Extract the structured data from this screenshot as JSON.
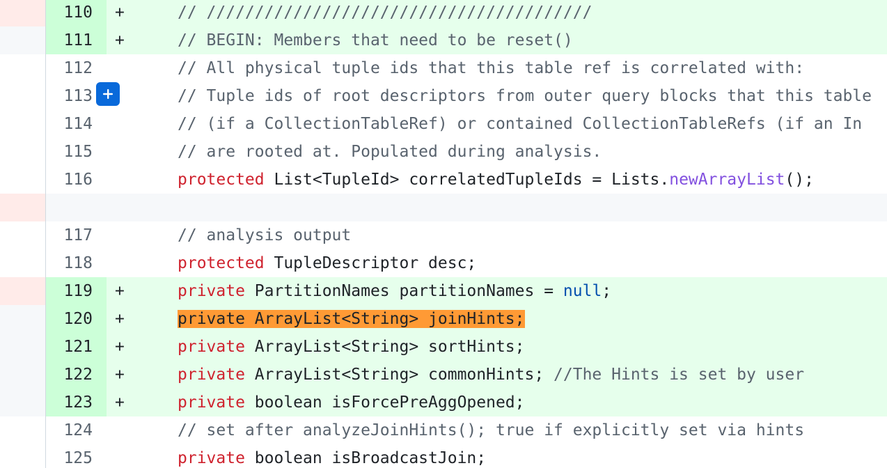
{
  "lines": [
    {
      "num": "110",
      "marker": "+",
      "code": "// ////////////////////////////////////////"
    },
    {
      "num": "111",
      "marker": "+",
      "code": "// BEGIN: Members that need to be reset()"
    },
    {
      "num": "112",
      "marker": "",
      "code": "// All physical tuple ids that this table ref is correlated with:"
    },
    {
      "num": "113",
      "marker": "",
      "code": "// Tuple ids of root descriptors from outer query blocks that this table"
    },
    {
      "num": "114",
      "marker": "",
      "code": "// (if a CollectionTableRef) or contained CollectionTableRefs (if an In"
    },
    {
      "num": "115",
      "marker": "",
      "code": "// are rooted at. Populated during analysis."
    },
    {
      "num": "116",
      "marker": "",
      "kw": "protected",
      "rest1": " List<TupleId> correlatedTupleIds = Lists.",
      "fn": "newArrayList",
      "rest2": "();"
    },
    {
      "num": "117",
      "marker": "",
      "code": "// analysis output"
    },
    {
      "num": "118",
      "marker": "",
      "kw": "protected",
      "rest": " TupleDescriptor desc;"
    },
    {
      "num": "119",
      "marker": "+",
      "kw": "private",
      "rest1": " PartitionNames partitionNames = ",
      "lit": "null",
      "rest2": ";"
    },
    {
      "num": "120",
      "marker": "+",
      "code": "private ArrayList<String> joinHints;"
    },
    {
      "num": "121",
      "marker": "+",
      "kw": "private",
      "rest": " ArrayList<String> sortHints;"
    },
    {
      "num": "122",
      "marker": "+",
      "kw": "private",
      "rest": " ArrayList<String> commonHints; ",
      "comment": "//The Hints is set by user"
    },
    {
      "num": "123",
      "marker": "+",
      "kw": "private",
      "rest": " boolean isForcePreAggOpened;"
    },
    {
      "num": "124",
      "marker": "",
      "code": "// set after analyzeJoinHints(); true if explicitly set via hints"
    },
    {
      "num": "125",
      "marker": "",
      "kw": "private",
      "rest": " boolean isBroadcastJoin;"
    }
  ],
  "icons": {
    "add_comment": "plus-icon"
  },
  "colors": {
    "added_bg": "#e6ffec",
    "added_num_bg": "#ccffd8",
    "deleted_bg": "#ffebe9",
    "keyword": "#cf222e",
    "function": "#8250df",
    "literal": "#0550ae",
    "highlight": "#ff9a35",
    "accent": "#0969da"
  }
}
